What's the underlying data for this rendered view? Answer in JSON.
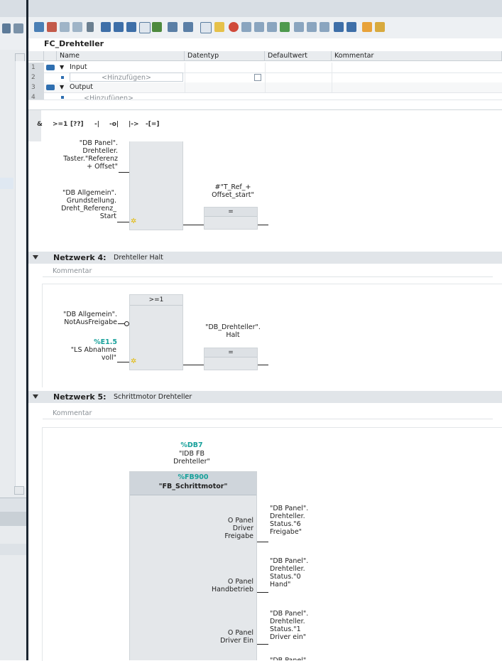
{
  "interface": {
    "block_name": "FC_Drehteller",
    "columns": [
      "Name",
      "Datentyp",
      "Defaultwert",
      "Kommentar"
    ],
    "rows": [
      {
        "num": "1",
        "name": "Input",
        "kind": "section"
      },
      {
        "num": "2",
        "name": "<Hinzufügen>",
        "kind": "add"
      },
      {
        "num": "3",
        "name": "Output",
        "kind": "section"
      },
      {
        "num": "4",
        "name": "<Hinzufügen>",
        "kind": "add"
      }
    ]
  },
  "instruction_bar": {
    "items": [
      "&",
      ">=1",
      "[??]",
      "-|",
      "-o|",
      "|->",
      "-[=]"
    ]
  },
  "network3": {
    "input1": "\"DB Panel\".\nDrehteller.\nTaster.\"Referenz\n+ Offset\"",
    "input2": "\"DB Allgemein\".\nGrundstellung.\nDreht_Referenz_\nStart",
    "output": "#\"T_Ref_+\nOffset_start\"",
    "coil_symbol": "="
  },
  "network4": {
    "label": "Netzwerk 4:",
    "title": "Drehteller Halt",
    "comment": "Kommentar",
    "box_symbol": ">=1",
    "input1": "\"DB Allgemein\".\nNotAusFreigabe",
    "input2_addr": "%E1.5",
    "input2": "\"LS Abnahme\nvoll\"",
    "output": "\"DB_Drehteller\".\nHalt",
    "coil_symbol": "="
  },
  "network5": {
    "label": "Netzwerk 5:",
    "title": "Schrittmotor Drehteller",
    "comment": "Kommentar",
    "instance_addr": "%DB7",
    "instance_name": "\"IDB FB\nDrehteller\"",
    "fb_addr": "%FB900",
    "fb_name": "\"FB_Schrittmotor\"",
    "params": [
      {
        "name": "O Panel\nDriver\nFreigabe",
        "value": "\"DB Panel\".\nDrehteller.\nStatus.\"6\nFreigabe\""
      },
      {
        "name": "O Panel\nHandbetrieb",
        "value": "\"DB Panel\".\nDrehteller.\nStatus.\"0\nHand\""
      },
      {
        "name": "O Panel\nDriver Ein",
        "value": "\"DB Panel\".\nDrehteller.\nStatus.\"1\nDriver ein\""
      }
    ],
    "partial_param": "\"DB Panel\"."
  },
  "colors": {
    "address": "#16a09a",
    "header_bar": "#e1e5e9",
    "box": "#e4e7ea"
  }
}
